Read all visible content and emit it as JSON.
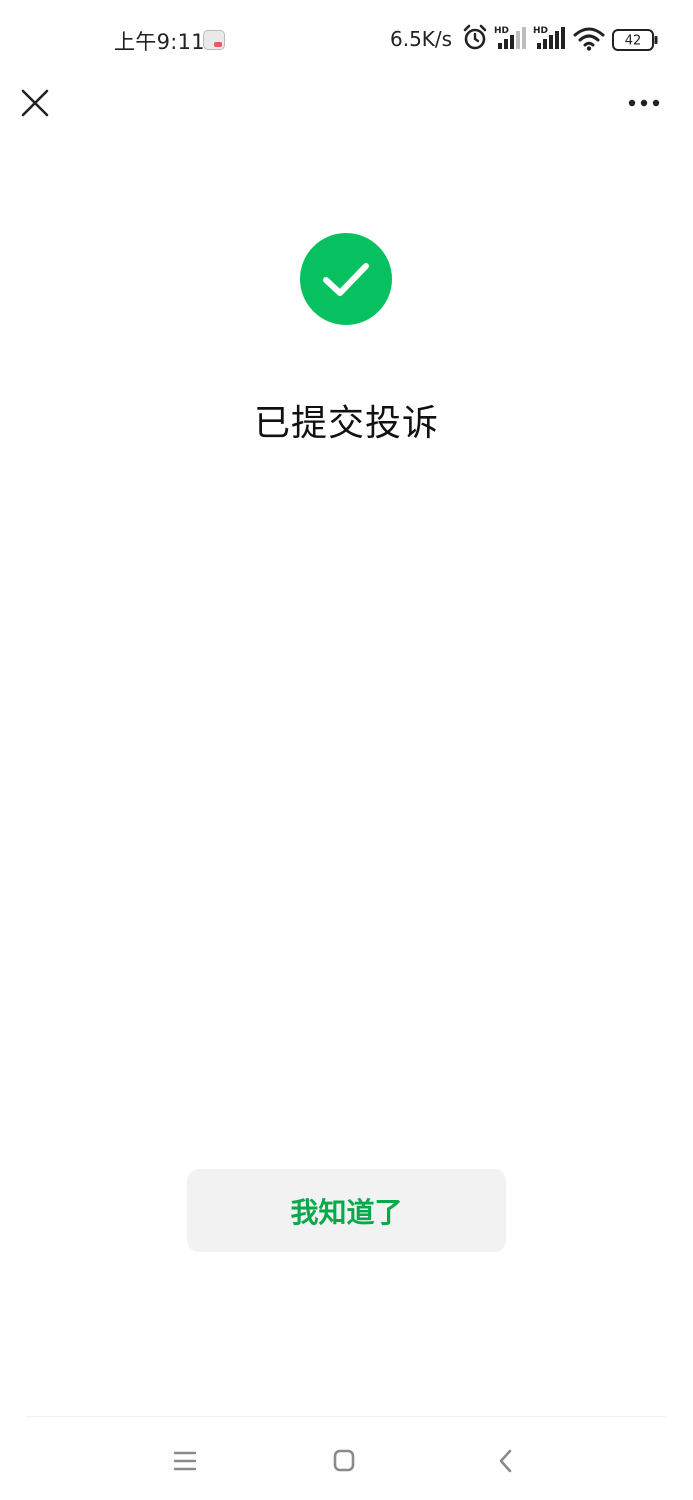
{
  "status_bar": {
    "time": "上午9:11",
    "network_speed": "6.5K/s",
    "battery_level": "42",
    "signal_1_label": "HD",
    "signal_2_label": "HD",
    "icons": [
      "app-notification-icon",
      "alarm-icon",
      "signal-hd-icon",
      "signal-hd-icon",
      "wifi-icon",
      "battery-icon"
    ]
  },
  "title_bar": {
    "icons": [
      "close-icon",
      "more-icon"
    ]
  },
  "result": {
    "icon": "check-circle-icon",
    "icon_color": "#07c160",
    "title": "已提交投诉"
  },
  "actions": {
    "acknowledge_label": "我知道了",
    "acknowledge_color": "#07a94a"
  },
  "nav_bar": {
    "icons": [
      "menu-icon",
      "home-icon",
      "back-icon"
    ]
  }
}
